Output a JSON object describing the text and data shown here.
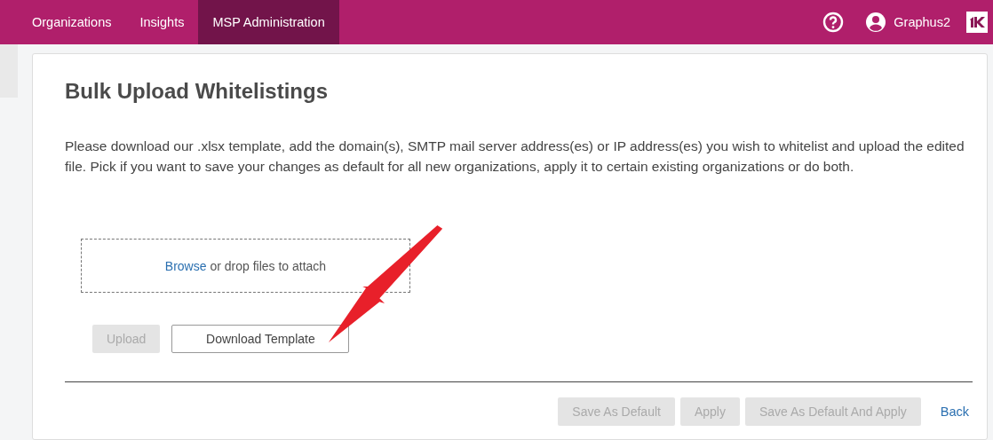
{
  "nav": {
    "tabs": [
      {
        "label": "Organizations",
        "selected": false
      },
      {
        "label": "Insights",
        "selected": false
      },
      {
        "label": "MSP Administration",
        "selected": true
      }
    ],
    "user": "Graphus2"
  },
  "page": {
    "title": "Bulk Upload Whitelistings",
    "description": "Please download our .xlsx template, add the domain(s), SMTP mail server address(es) or IP address(es) you wish to whitelist and upload the edited file. Pick if you want to save your changes as default for all new organizations, apply it to certain existing organizations or do both.",
    "dropzone": {
      "link": "Browse",
      "text": "or drop files to attach"
    },
    "file_buttons": [
      {
        "label": "Upload",
        "disabled": true
      },
      {
        "label": "Download Template",
        "disabled": false
      }
    ],
    "footer_buttons": [
      {
        "label": "Save As Default",
        "disabled": true
      },
      {
        "label": "Apply",
        "disabled": true
      },
      {
        "label": "Save As Default And Apply",
        "disabled": true
      }
    ],
    "back": "Back"
  }
}
